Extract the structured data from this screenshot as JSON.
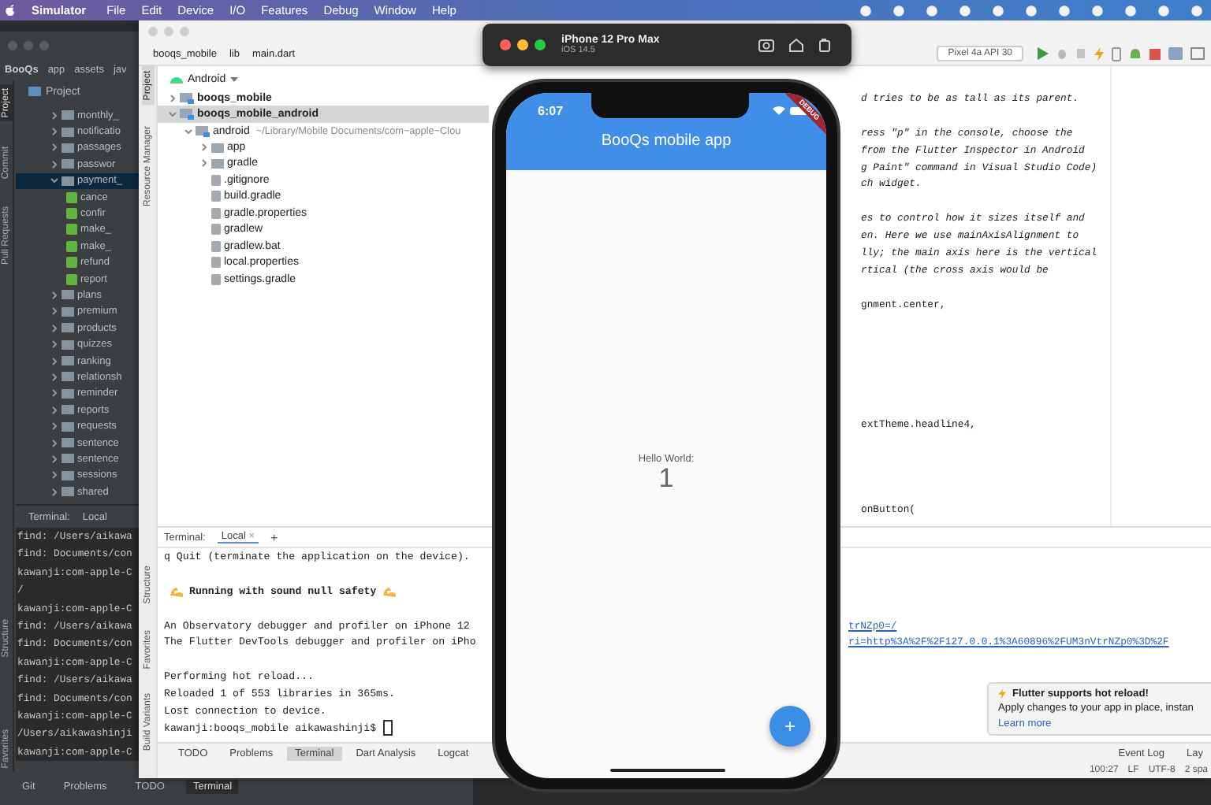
{
  "menu_bar": {
    "items": [
      "Simulator",
      "File",
      "Edit",
      "Device",
      "I/O",
      "Features",
      "Debug",
      "Window",
      "Help"
    ]
  },
  "back_ide": {
    "breadcrumb": [
      "BooQs",
      "app",
      "assets",
      "jav"
    ],
    "side_tabs": [
      {
        "label": "Project",
        "selected": true
      },
      {
        "label": "Commit",
        "selected": false
      },
      {
        "label": "Pull Requests",
        "selected": false
      }
    ],
    "lower_side_tabs": [
      "Structure",
      "Favorites"
    ],
    "panel_title": "Project",
    "tree": [
      {
        "label": "monthly_",
        "kind": "folder",
        "expanded": false,
        "selected": false
      },
      {
        "label": "notificatio",
        "kind": "folder",
        "expanded": false,
        "selected": false
      },
      {
        "label": "passages",
        "kind": "folder",
        "expanded": false,
        "selected": false
      },
      {
        "label": "passwor",
        "kind": "folder",
        "expanded": false,
        "selected": false
      },
      {
        "label": "payment_",
        "kind": "folder",
        "expanded": true,
        "selected": true,
        "children": [
          {
            "label": "cance",
            "kind": "file",
            "selected": false
          },
          {
            "label": "confir",
            "kind": "file",
            "selected": false
          },
          {
            "label": "make_",
            "kind": "file",
            "selected": false
          },
          {
            "label": "make_",
            "kind": "file",
            "selected": false
          },
          {
            "label": "refund",
            "kind": "file",
            "selected": false
          },
          {
            "label": "report",
            "kind": "file",
            "selected": false
          }
        ]
      },
      {
        "label": "plans",
        "kind": "folder",
        "expanded": false,
        "selected": false
      },
      {
        "label": "premium",
        "kind": "folder",
        "expanded": false,
        "selected": false
      },
      {
        "label": "products",
        "kind": "folder",
        "expanded": false,
        "selected": false
      },
      {
        "label": "quizzes",
        "kind": "folder",
        "expanded": false,
        "selected": false
      },
      {
        "label": "ranking",
        "kind": "folder",
        "expanded": false,
        "selected": false
      },
      {
        "label": "relationsh",
        "kind": "folder",
        "expanded": false,
        "selected": false
      },
      {
        "label": "reminder",
        "kind": "folder",
        "expanded": false,
        "selected": false
      },
      {
        "label": "reports",
        "kind": "folder",
        "expanded": false,
        "selected": false
      },
      {
        "label": "requests",
        "kind": "folder",
        "expanded": false,
        "selected": false
      },
      {
        "label": "sentence",
        "kind": "folder",
        "expanded": false,
        "selected": false
      },
      {
        "label": "sentence",
        "kind": "folder",
        "expanded": false,
        "selected": false
      },
      {
        "label": "sessions",
        "kind": "folder",
        "expanded": false,
        "selected": false
      },
      {
        "label": "shared",
        "kind": "folder",
        "expanded": false,
        "selected": false
      }
    ],
    "terminal": {
      "title": "Terminal:",
      "session": "Local",
      "lines": [
        "find: /Users/aikawa",
        "find: Documents/con",
        "kawanji:com-apple-C",
        "/",
        "kawanji:com-apple-C",
        "find: /Users/aikawa",
        "find: Documents/con",
        "kawanji:com-apple-C",
        "find: /Users/aikawa",
        "find: Documents/con",
        "kawanji:com-apple-C",
        "/Users/aikawashinji",
        "kawanji:com-apple-C"
      ]
    },
    "tool_tabs": [
      {
        "label": "Git",
        "selected": false
      },
      {
        "label": "Problems",
        "selected": false
      },
      {
        "label": "TODO",
        "selected": false
      },
      {
        "label": "Terminal",
        "selected": true
      }
    ]
  },
  "front_ide": {
    "breadcrumb": [
      "booqs_mobile",
      "lib",
      "main.dart"
    ],
    "device_selector": "Pixel 4a API 30",
    "side_tabs": [
      {
        "label": "Project",
        "selected": true
      },
      {
        "label": "Resource Manager",
        "selected": false
      }
    ],
    "lower_side_tabs": [
      "Structure",
      "Favorites",
      "Build Variants"
    ],
    "panel_view": "Android",
    "tree": [
      {
        "label": "booqs_mobile",
        "kind": "project",
        "expanded": false,
        "selected": false
      },
      {
        "label": "booqs_mobile_android",
        "kind": "project",
        "expanded": true,
        "selected": true,
        "children": [
          {
            "label": "android",
            "kind": "module",
            "hint": "~/Library/Mobile Documents/com~apple~Clou",
            "expanded": true,
            "selected": false,
            "children": [
              {
                "label": "app",
                "kind": "folder",
                "expanded": false,
                "selected": false
              },
              {
                "label": "gradle",
                "kind": "folder",
                "expanded": false,
                "selected": false
              },
              {
                "label": ".gitignore",
                "kind": "file",
                "selected": false
              },
              {
                "label": "build.gradle",
                "kind": "file",
                "selected": false
              },
              {
                "label": "gradle.properties",
                "kind": "file",
                "selected": false
              },
              {
                "label": "gradlew",
                "kind": "file",
                "selected": false
              },
              {
                "label": "gradlew.bat",
                "kind": "file",
                "selected": false
              },
              {
                "label": "local.properties",
                "kind": "file",
                "selected": false
              },
              {
                "label": "settings.gradle",
                "kind": "file",
                "selected": false
              }
            ]
          }
        ]
      }
    ],
    "editor": {
      "blocks": [
        {
          "lines": [
            {
              "text": "d tries to be as tall as its parent.",
              "kind": "comment"
            }
          ]
        },
        {
          "lines": [
            {
              "text": "ress \"p\" in the console, choose the",
              "kind": "comment"
            },
            {
              "text": "from the Flutter Inspector in Android",
              "kind": "comment"
            },
            {
              "text": "g Paint\" command in Visual Studio Code)",
              "kind": "comment"
            },
            {
              "text": "ch widget.",
              "kind": "comment"
            }
          ]
        },
        {
          "lines": [
            {
              "text": "es to control how it sizes itself and",
              "kind": "comment"
            },
            {
              "text": "en. Here we use mainAxisAlignment to",
              "kind": "comment"
            },
            {
              "text": "lly; the main axis here is the vertical",
              "kind": "comment"
            },
            {
              "text": "rtical (the cross axis would be",
              "kind": "comment"
            }
          ]
        },
        {
          "lines": [
            {
              "text": "gnment.center,",
              "kind": "code"
            }
          ]
        },
        {
          "lines": [
            {
              "text": "extTheme.headline4,",
              "kind": "code"
            }
          ]
        },
        {
          "lines": [
            {
              "text": "onButton(",
              "kind": "code"
            }
          ]
        }
      ]
    },
    "terminal": {
      "title": "Terminal:",
      "session": "Local",
      "close": "×",
      "add": "+",
      "blocks": [
        {
          "lines": [
            {
              "text": "q Quit (terminate the application on the device).",
              "kind": "plain"
            }
          ]
        },
        {
          "lines": [
            {
              "text": "Running with sound null safety",
              "kind": "highlight"
            }
          ]
        },
        {
          "lines": [
            {
              "text": "An Observatory debugger and profiler on iPhone 12",
              "kind": "plain",
              "link": "trNZp0=/"
            },
            {
              "text": "The Flutter DevTools debugger and profiler on iPho",
              "kind": "plain",
              "link": "ri=http%3A%2F%2F127.0.0.1%3A60896%2FUM3nVtrNZp0%3D%2F"
            }
          ]
        },
        {
          "lines": [
            {
              "text": "Performing hot reload...",
              "kind": "plain"
            },
            {
              "text": "Reloaded 1 of 553 libraries in 365ms.",
              "kind": "plain"
            },
            {
              "text": "Lost connection to device.",
              "kind": "plain"
            },
            {
              "text": "kawanji:booqs_mobile aikawashinji$",
              "kind": "prompt"
            }
          ]
        }
      ]
    },
    "notification": {
      "title": "Flutter supports hot reload!",
      "body": "Apply changes to your app in place, instan",
      "link": "Learn more"
    },
    "tool_tabs": [
      {
        "label": "TODO",
        "selected": false
      },
      {
        "label": "Problems",
        "selected": false
      },
      {
        "label": "Terminal",
        "selected": true
      },
      {
        "label": "Dart Analysis",
        "selected": false
      },
      {
        "label": "Logcat",
        "selected": false
      }
    ],
    "right_tabs": [
      "Event Log",
      "Lay"
    ],
    "status": [
      "100:27",
      "LF",
      "UTF-8",
      "2 spa"
    ]
  },
  "simulator": {
    "title": "iPhone 12 Pro Max",
    "subtitle": "iOS 14.5"
  },
  "phone": {
    "time": "6:07",
    "app_title": "BooQs mobile app",
    "debug_banner": "DEBUG",
    "label": "Hello World:",
    "counter": "1",
    "fab": "+"
  }
}
